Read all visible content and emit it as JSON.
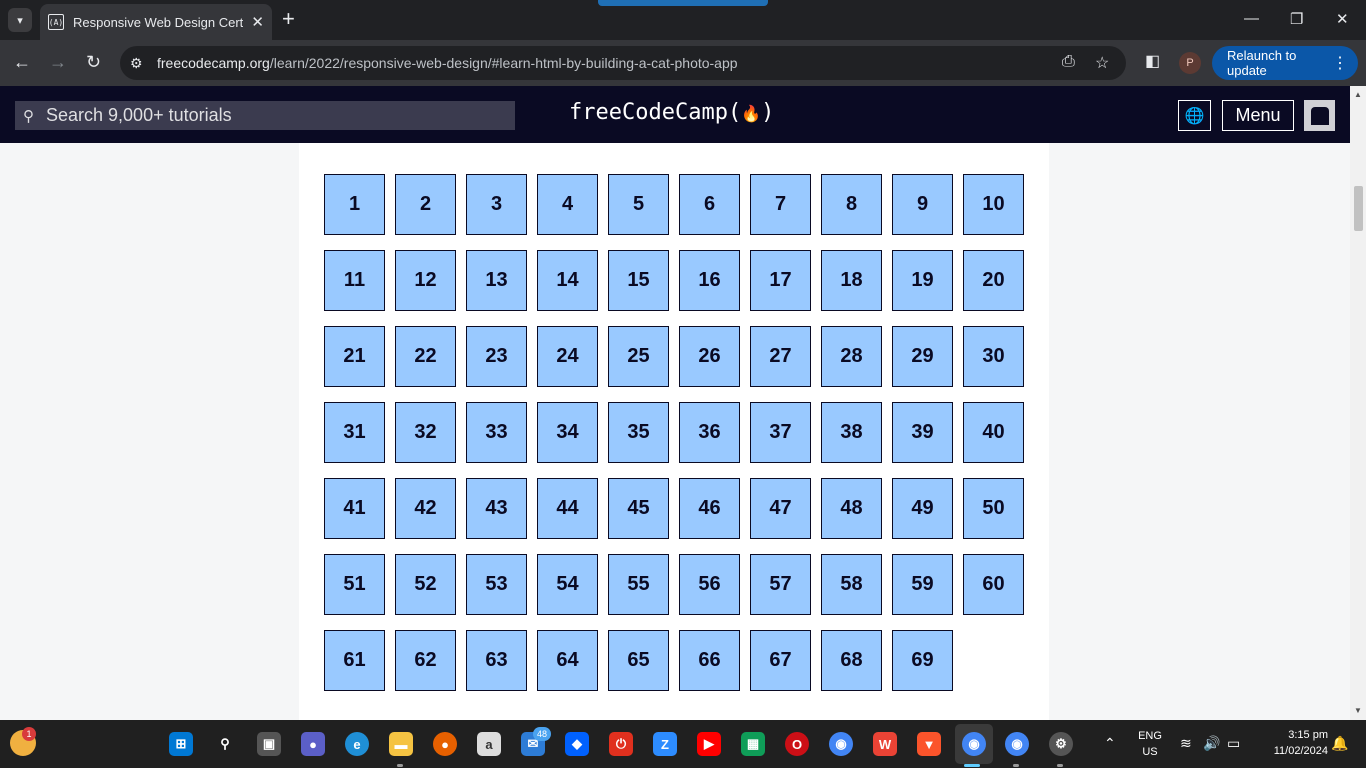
{
  "browser": {
    "tab": {
      "title": "Responsive Web Design Certific",
      "favicon": "(A)",
      "close": "✕"
    },
    "new_tab": "+",
    "window_controls": {
      "minimize": "—",
      "restore": "❐",
      "close": "✕"
    },
    "url": {
      "host": "freecodecamp.org",
      "path": "/learn/2022/responsive-web-design/#learn-html-by-building-a-cat-photo-app"
    },
    "profile_initial": "P",
    "relaunch_label": "Relaunch to update",
    "menu_dots": "⋮"
  },
  "fcc": {
    "search_placeholder": "Search 9,000+ tutorials",
    "logo_text": "freeCodeCamp(",
    "logo_flame": "🔥",
    "logo_close": ")",
    "menu_label": "Menu",
    "lang_icon": "🌐"
  },
  "steps": [
    "1",
    "2",
    "3",
    "4",
    "5",
    "6",
    "7",
    "8",
    "9",
    "10",
    "11",
    "12",
    "13",
    "14",
    "15",
    "16",
    "17",
    "18",
    "19",
    "20",
    "21",
    "22",
    "23",
    "24",
    "25",
    "26",
    "27",
    "28",
    "29",
    "30",
    "31",
    "32",
    "33",
    "34",
    "35",
    "36",
    "37",
    "38",
    "39",
    "40",
    "41",
    "42",
    "43",
    "44",
    "45",
    "46",
    "47",
    "48",
    "49",
    "50",
    "51",
    "52",
    "53",
    "54",
    "55",
    "56",
    "57",
    "58",
    "59",
    "60",
    "61",
    "62",
    "63",
    "64",
    "65",
    "66",
    "67",
    "68",
    "69"
  ],
  "taskbar": {
    "weather_badge": "1",
    "mail_badge": "48",
    "language": "ENG",
    "region": "US",
    "time": "3:15 pm",
    "date": "11/02/2024"
  },
  "colors": {
    "step_bg": "#99c9ff",
    "nav_bg": "#0a0a23",
    "relaunch_bg": "#0b57a8"
  }
}
